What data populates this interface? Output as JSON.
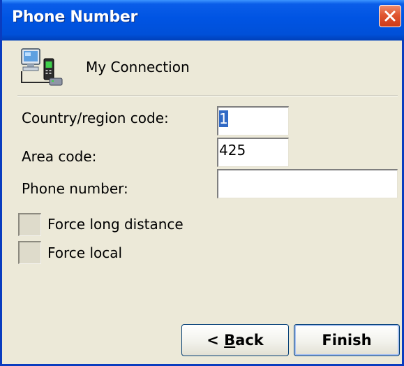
{
  "window": {
    "title": "Phone Number",
    "close_icon": "close-icon"
  },
  "connection": {
    "icon": "network-connection-icon",
    "name": "My Connection"
  },
  "form": {
    "country_label": "Country/region code:",
    "country_value": "1",
    "area_label": "Area code:",
    "area_value": "425",
    "phone_label": "Phone number:",
    "phone_value": "",
    "force_long_distance_label": "Force long distance",
    "force_long_distance_checked": false,
    "force_local_label": "Force local",
    "force_local_checked": false
  },
  "buttons": {
    "back_prefix": "< ",
    "back_mnemonic": "B",
    "back_rest": "ack",
    "finish_label": "Finish"
  },
  "colors": {
    "title_bar": "#0054e3",
    "dialog_bg": "#ece9d8",
    "close_button": "#e0552f",
    "selection": "#316ac5"
  }
}
